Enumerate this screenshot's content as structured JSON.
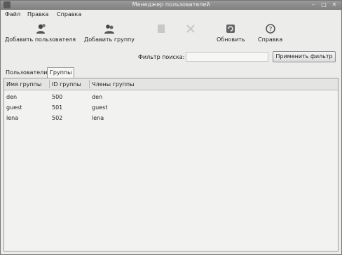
{
  "window": {
    "title": "Менеджер пользователей"
  },
  "menu": {
    "items": [
      "Файл",
      "Правка",
      "Справка"
    ]
  },
  "toolbar": {
    "add_user": "Добавить пользователя",
    "add_group": "Добавить группу",
    "refresh": "Обновить",
    "help": "Справка"
  },
  "filter": {
    "label": "Фильтр поиска:",
    "value": "",
    "apply": "Применить фильтр"
  },
  "tabs": [
    "Пользователи",
    "Группы"
  ],
  "table": {
    "headers": [
      "Имя группы",
      "ID группы",
      "Члены группы"
    ],
    "rows": [
      [
        "den",
        "500",
        "den"
      ],
      [
        "guest",
        "501",
        "guest"
      ],
      [
        "lena",
        "502",
        "lena"
      ]
    ]
  }
}
